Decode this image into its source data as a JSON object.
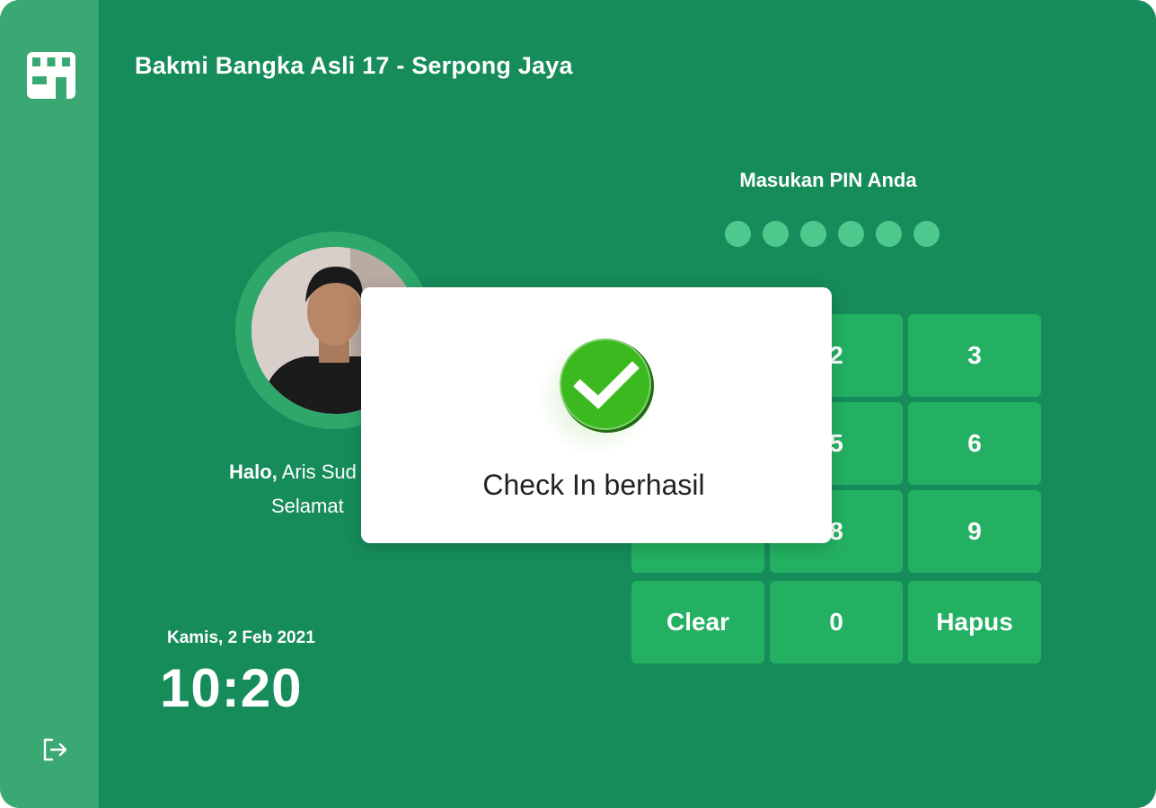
{
  "header": {
    "title": "Bakmi Bangka Asli 17 - Serpong Jaya"
  },
  "sidebar": {
    "top_icon": "store-icon",
    "bottom_icon": "logout-icon"
  },
  "user": {
    "hello": "Halo,",
    "name_visible": " Aris Sud",
    "welcome_visible": "Selamat "
  },
  "clock": {
    "date": "Kamis, 2 Feb 2021",
    "time": "10:20"
  },
  "pin": {
    "label": "Masukan PIN Anda",
    "dots": 6
  },
  "keypad": {
    "k1": "",
    "k2": "2",
    "k3": "3",
    "k4": "",
    "k5": "5",
    "k6": "6",
    "k7": "",
    "k8": "8",
    "k9": "9",
    "clear": "Clear",
    "k0": "0",
    "delete": "Hapus"
  },
  "modal": {
    "message": "Check In berhasil",
    "icon": "check-circle-icon"
  },
  "colors": {
    "background": "#168c5a",
    "sidebar": "#3aa872",
    "key": "#23b062",
    "pin_dot": "#4ec98d",
    "success": "#3cb91f"
  }
}
